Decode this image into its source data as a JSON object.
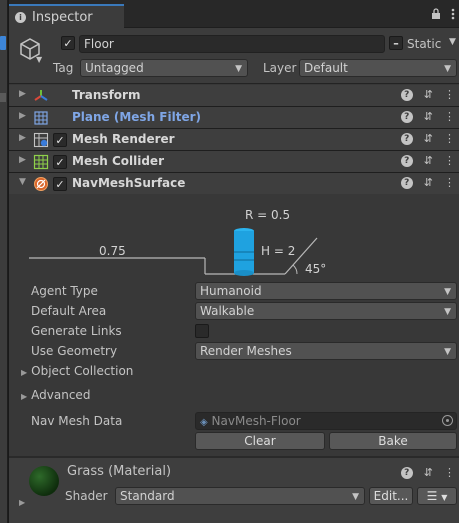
{
  "tab": {
    "title": "Inspector"
  },
  "header": {
    "object_name": "Floor",
    "static_label": "Static",
    "tag_label": "Tag",
    "tag_value": "Untagged",
    "layer_label": "Layer",
    "layer_value": "Default"
  },
  "components": [
    {
      "title": "Transform",
      "has_checkbox": false,
      "icon": "transform-icon"
    },
    {
      "title": "Plane (Mesh Filter)",
      "has_checkbox": false,
      "icon": "mesh-filter-icon"
    },
    {
      "title": "Mesh Renderer",
      "has_checkbox": true,
      "icon": "mesh-renderer-icon"
    },
    {
      "title": "Mesh Collider",
      "has_checkbox": true,
      "icon": "mesh-collider-icon"
    },
    {
      "title": "NavMeshSurface",
      "has_checkbox": true,
      "icon": "navmesh-surface-icon"
    }
  ],
  "navmesh": {
    "diagram": {
      "radius": "R = 0.5",
      "height": "H = 2",
      "step": "0.75",
      "slope": "45°"
    },
    "agent_type_label": "Agent Type",
    "agent_type_value": "Humanoid",
    "default_area_label": "Default Area",
    "default_area_value": "Walkable",
    "generate_links_label": "Generate Links",
    "generate_links_checked": false,
    "use_geometry_label": "Use Geometry",
    "use_geometry_value": "Render Meshes",
    "object_collection_label": "Object Collection",
    "advanced_label": "Advanced",
    "nav_mesh_data_label": "Nav Mesh Data",
    "nav_mesh_data_value": "NavMesh-Floor",
    "clear_label": "Clear",
    "bake_label": "Bake"
  },
  "material": {
    "name": "Grass (Material)",
    "shader_label": "Shader",
    "shader_value": "Standard",
    "edit_label": "Edit..."
  },
  "colors": {
    "accent_blue": "#3d86d9",
    "capsule": "#1fa2e0",
    "mesh_filter_title": "#7fa6e6"
  }
}
